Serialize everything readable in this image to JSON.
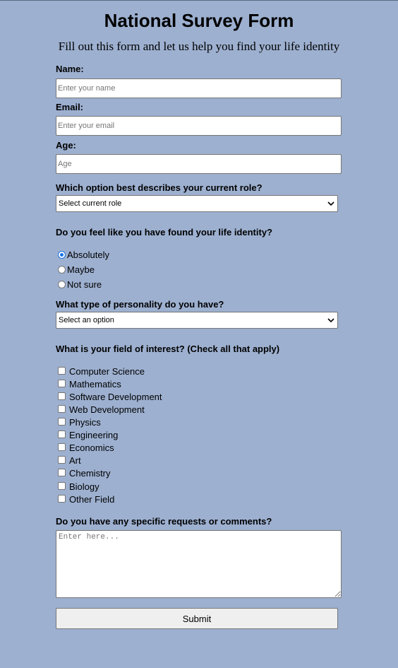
{
  "header": {
    "title": "National Survey Form",
    "subtitle": "Fill out this form and let us help you find your life identity"
  },
  "name_field": {
    "label": "Name:",
    "placeholder": "Enter your name"
  },
  "email_field": {
    "label": "Email:",
    "placeholder": "Enter your email"
  },
  "age_field": {
    "label": "Age:",
    "placeholder": "Age"
  },
  "role_select": {
    "label": "Which option best describes your current role?",
    "selected": "Select current role"
  },
  "identity_question": {
    "label": "Do you feel like you have found your life identity?",
    "options": [
      {
        "label": "Absolutely",
        "checked": true
      },
      {
        "label": "Maybe",
        "checked": false
      },
      {
        "label": "Not sure",
        "checked": false
      }
    ]
  },
  "personality_select": {
    "label": "What type of personality do you have?",
    "selected": "Select an option"
  },
  "interests": {
    "label": "What is your field of interest? (Check all that apply)",
    "options": [
      "Computer Science",
      "Mathematics",
      "Software Development",
      "Web Development",
      "Physics",
      "Engineering",
      "Economics",
      "Art",
      "Chemistry",
      "Biology",
      "Other Field"
    ]
  },
  "comments": {
    "label": "Do you have any specific requests or comments?",
    "placeholder": "Enter here..."
  },
  "submit": {
    "label": "Submit"
  },
  "colors": {
    "background": "#9db0d0",
    "radio_accent": "#1a73e8",
    "button_bg": "#efefef"
  }
}
